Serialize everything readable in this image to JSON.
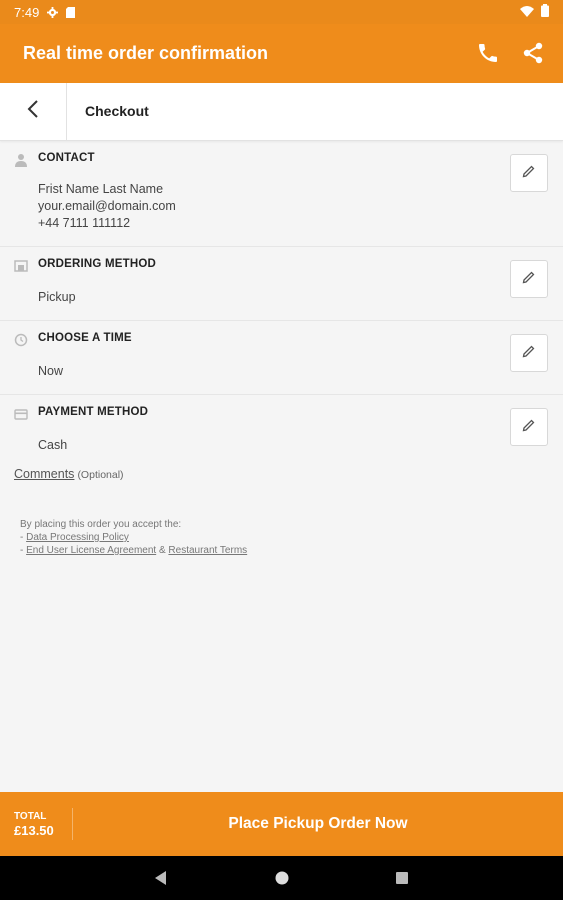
{
  "status": {
    "time": "7:49"
  },
  "appbar": {
    "title": "Real time order confirmation",
    "phone_icon": "phone-icon",
    "share_icon": "share-icon"
  },
  "subbar": {
    "title": "Checkout",
    "back_icon": "arrow-left-icon"
  },
  "contact": {
    "heading": "CONTACT",
    "name": "Frist Name Last Name",
    "email": "your.email@domain.com",
    "phone": "+44 7111 111112"
  },
  "ordering": {
    "heading": "ORDERING METHOD",
    "value": "Pickup"
  },
  "time": {
    "heading": "CHOOSE A TIME",
    "value": "Now"
  },
  "payment": {
    "heading": "PAYMENT METHOD",
    "value": "Cash"
  },
  "comments": {
    "label": "Comments",
    "optional": "(Optional)"
  },
  "legal": {
    "intro": "By placing this order you accept the:",
    "dash": "- ",
    "policy": "Data Processing Policy",
    "eula": "End User License Agreement",
    "amp": " & ",
    "terms": "Restaurant Terms"
  },
  "footer": {
    "total_label": "TOTAL",
    "total_amount": "£13.50",
    "place_button": "Place Pickup Order Now"
  },
  "colors": {
    "accent": "#ef8c1b",
    "background": "#f5f5f5"
  }
}
